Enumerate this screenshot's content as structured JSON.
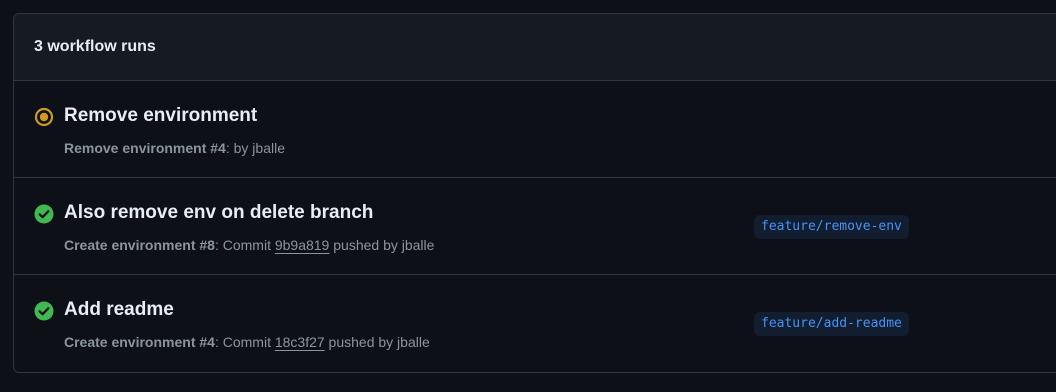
{
  "header": {
    "run_count_label": "3 workflow runs"
  },
  "colors": {
    "in_progress": "#d29922",
    "success": "#3fb950",
    "branch_text": "#4493f8"
  },
  "runs": [
    {
      "status": "in-progress",
      "status_icon": "in-progress-icon",
      "title": "Remove environment",
      "workflow": "Remove environment",
      "run_number": " #4",
      "meta_suffix": ": by jballe",
      "commit": "",
      "after_commit": "",
      "branch": ""
    },
    {
      "status": "success",
      "status_icon": "check-circle-icon",
      "title": "Also remove env on delete branch",
      "workflow": "Create environment",
      "run_number": " #8",
      "meta_suffix": ": Commit ",
      "commit": "9b9a819",
      "after_commit": " pushed by jballe",
      "branch": "feature/remove-env"
    },
    {
      "status": "success",
      "status_icon": "check-circle-icon",
      "title": "Add readme",
      "workflow": "Create environment",
      "run_number": " #4",
      "meta_suffix": ": Commit ",
      "commit": "18c3f27",
      "after_commit": " pushed by jballe",
      "branch": "feature/add-readme"
    }
  ]
}
